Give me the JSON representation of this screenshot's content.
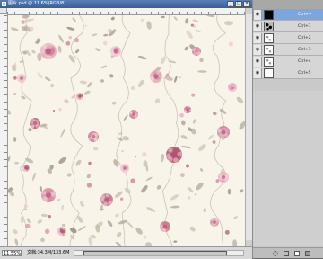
{
  "window": {
    "title": "图片.psd @ 11.6%(RGB/8)",
    "buttons": {
      "minimize": "_",
      "maximize": "□",
      "close": "×"
    }
  },
  "status": {
    "zoom": "11.55%",
    "doc_info": "文档:34.3M/133.6M"
  },
  "channels": [
    {
      "label": "Ctrl+~",
      "selected": true,
      "thumb": "black"
    },
    {
      "label": "Ctrl+1",
      "selected": false,
      "thumb": "mixed"
    },
    {
      "label": "Ctrl+2",
      "selected": false,
      "thumb": "sketch"
    },
    {
      "label": "Ctrl+3",
      "selected": false,
      "thumb": "sketch"
    },
    {
      "label": "Ctrl+4",
      "selected": false,
      "thumb": "sketch"
    },
    {
      "label": "Ctrl+5",
      "selected": false,
      "thumb": "white"
    }
  ],
  "icons": {
    "eye": "eye-icon",
    "load-selection": "dotted-circle-icon",
    "save-selection": "mask-icon",
    "new-channel": "new-page-icon",
    "delete": "trash-icon"
  },
  "colors": {
    "canvas_bg": "#f9f4ea",
    "rose_pink": "#d88aa2",
    "rose_dark": "#b0506e",
    "leaf": "#a89a8a",
    "selection_blue": "#7fa6dc"
  }
}
